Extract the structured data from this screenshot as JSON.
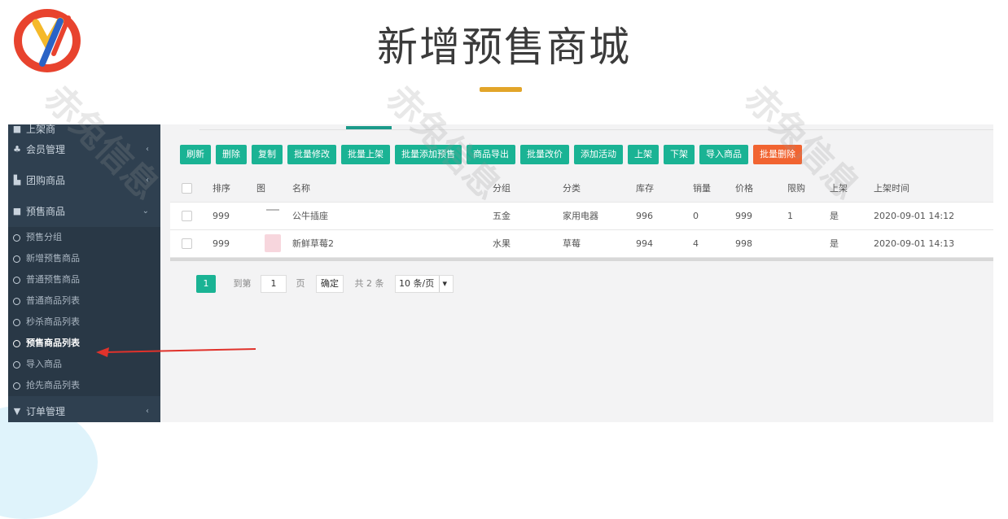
{
  "slide": {
    "title": "新增预售商城"
  },
  "sidebar": {
    "top_item": "上架商",
    "items": [
      {
        "label": "会员管理",
        "icon": "users-icon"
      },
      {
        "label": "团购商品",
        "icon": "chart-icon"
      },
      {
        "label": "预售商品",
        "icon": "briefcase-icon"
      }
    ],
    "sub_items": [
      "预售分组",
      "新增预售商品",
      "普通预售商品",
      "普通商品列表",
      "秒杀商品列表",
      "预售商品列表",
      "导入商品",
      "抢先商品列表"
    ],
    "bottom_item": "订单管理"
  },
  "toolbar": {
    "buttons": [
      "刷新",
      "删除",
      "复制",
      "批量修改",
      "批量上架",
      "批量添加预售",
      "商品导出",
      "批量改价",
      "添加活动",
      "上架",
      "下架",
      "导入商品"
    ],
    "danger_button": "批量删除"
  },
  "table": {
    "headers": [
      "排序",
      "图",
      "名称",
      "分组",
      "分类",
      "库存",
      "销量",
      "价格",
      "限购",
      "上架",
      "上架时间"
    ],
    "rows": [
      {
        "sort": "999",
        "name": "公牛插座",
        "group": "五金",
        "category": "家用电器",
        "stock": "996",
        "sales": "0",
        "price": "999",
        "limit": "1",
        "status": "是",
        "time": "2020-09-01 14:12"
      },
      {
        "sort": "999",
        "name": "新鲜草莓2",
        "group": "水果",
        "category": "草莓",
        "stock": "994",
        "sales": "4",
        "price": "998",
        "limit": "",
        "status": "是",
        "time": "2020-09-01 14:13"
      }
    ]
  },
  "pager": {
    "current": "1",
    "goto_label": "到第",
    "page_value": "1",
    "page_unit": "页",
    "confirm": "确定",
    "total": "共 2 条",
    "per_page": "10 条/页"
  },
  "watermark": {
    "text": "赤兔信息"
  },
  "colors": {
    "primary": "#1ab394",
    "danger": "#f16431",
    "sidebar": "#2f4050",
    "accent": "#e2a529"
  }
}
